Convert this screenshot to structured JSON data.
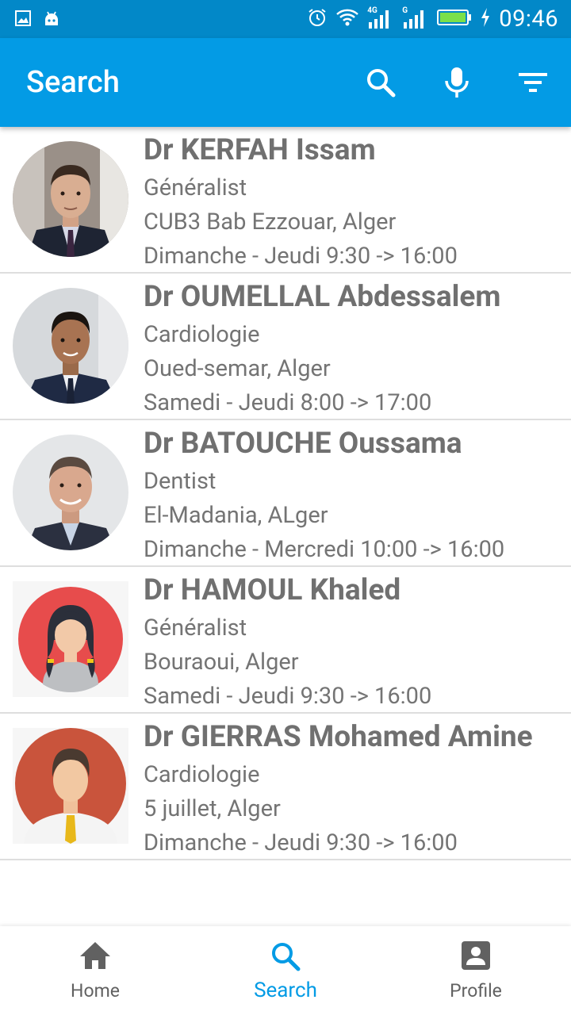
{
  "status_bar": {
    "time": "09:46",
    "icons": [
      "image-icon",
      "android-icon",
      "alarm-icon",
      "wifi-icon",
      "signal-4g-icon",
      "signal-g-icon",
      "battery-icon",
      "charging-icon"
    ],
    "network_1": "4G",
    "network_2": "G"
  },
  "app_bar": {
    "title": "Search",
    "actions": [
      "search-icon",
      "mic-icon",
      "filter-icon"
    ]
  },
  "doctors": [
    {
      "name": "Dr KERFAH Issam",
      "specialty": "Généralist",
      "location": "CUB3 Bab Ezzouar, Alger",
      "schedule": "Dimanche - Jeudi 9:30 -> 16:00"
    },
    {
      "name": "Dr OUMELLAL Abdessalem",
      "specialty": "Cardiologie",
      "location": "Oued-semar, Alger",
      "schedule": "Samedi - Jeudi 8:00 -> 17:00"
    },
    {
      "name": "Dr BATOUCHE Oussama",
      "specialty": "Dentist",
      "location": "El-Madania, ALger",
      "schedule": "Dimanche - Mercredi 10:00 -> 16:00"
    },
    {
      "name": "Dr HAMOUL Khaled",
      "specialty": "Généralist",
      "location": "Bouraoui, Alger",
      "schedule": "Samedi - Jeudi 9:30 -> 16:00"
    },
    {
      "name": "Dr GIERRAS Mohamed Amine",
      "specialty": "Cardiologie",
      "location": "5 juillet, Alger",
      "schedule": "Dimanche - Jeudi 9:30 -> 16:00"
    }
  ],
  "bottom_nav": {
    "items": [
      {
        "label": "Home",
        "icon": "home-icon"
      },
      {
        "label": "Search",
        "icon": "search-icon"
      },
      {
        "label": "Profile",
        "icon": "profile-icon"
      }
    ],
    "active": "Search"
  },
  "colors": {
    "primary": "#039be5",
    "status_bar": "#0288c8",
    "text": "#747474"
  }
}
